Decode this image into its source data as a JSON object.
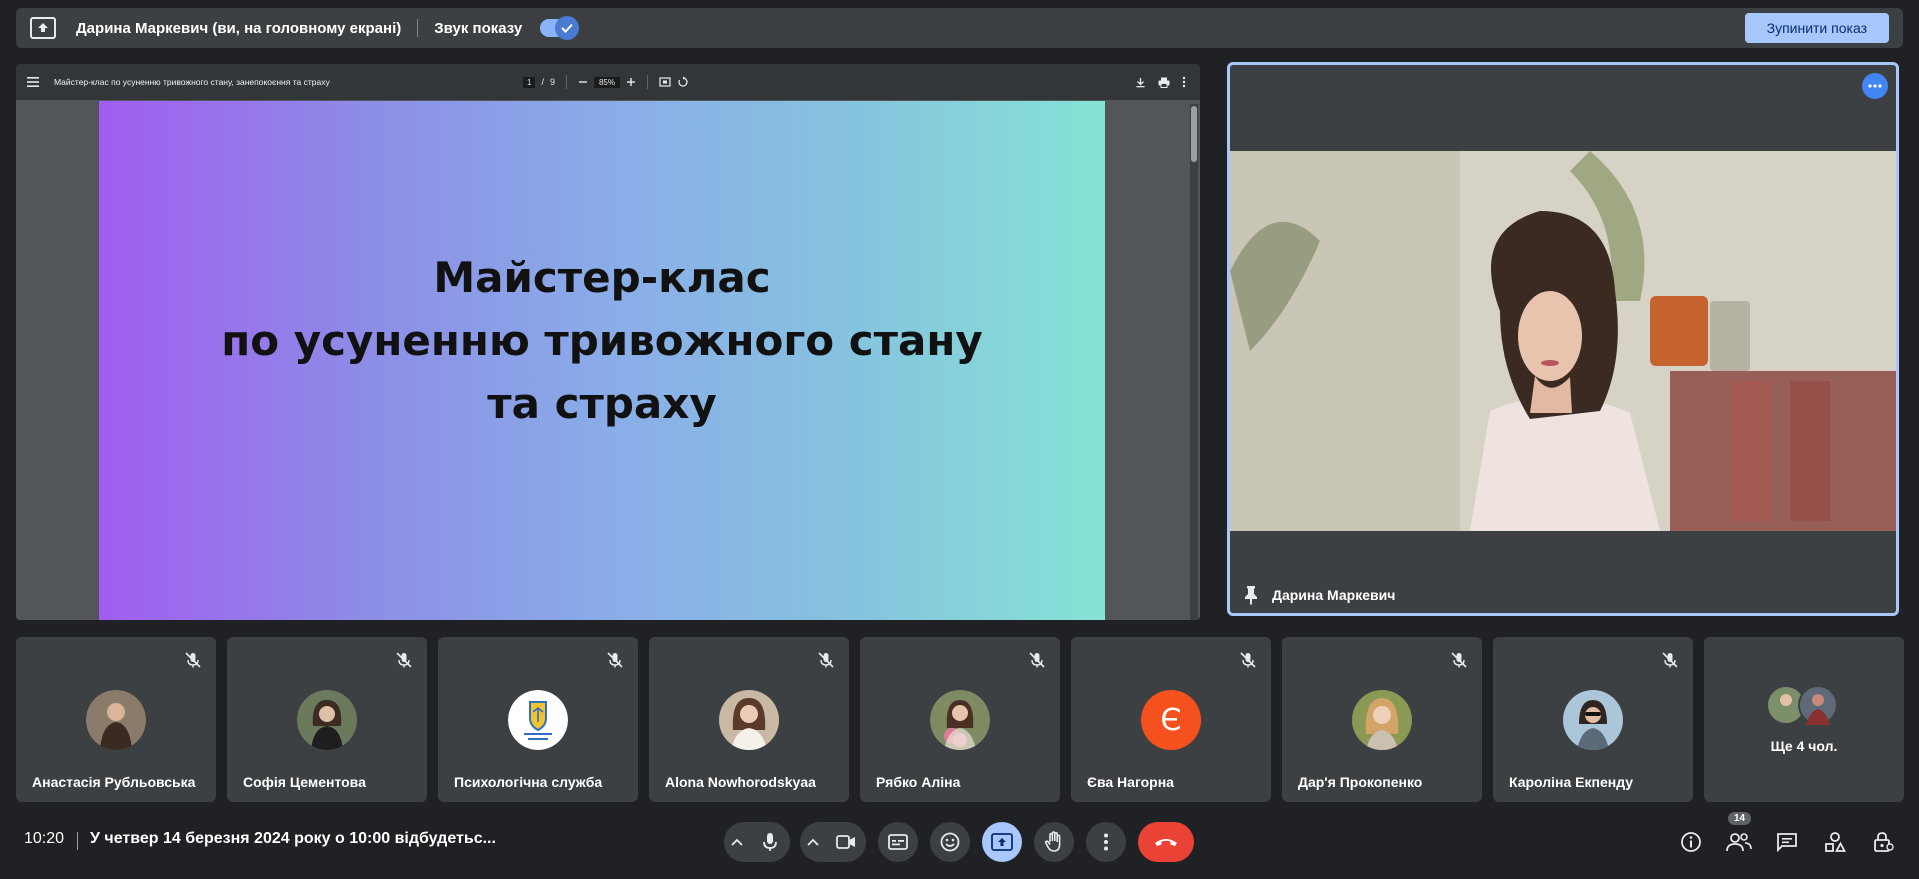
{
  "presenting_bar": {
    "presenter_label": "Дарина Маркевич (ви, на головному екрані)",
    "audio_label": "Звук показу",
    "audio_enabled": true,
    "stop_button": "Зупинити показ"
  },
  "pdf": {
    "doc_title": "Майстер-клас по усуненню тривожного стану, занепокоєння та страху",
    "page_current": "1",
    "page_separator": "/",
    "page_total": "9",
    "zoom": "85%",
    "slide_line1": "Майстер-клас",
    "slide_line2": "по усуненню тривожного стану",
    "slide_line3": "та страху"
  },
  "presenter_tile": {
    "name": "Дарина Маркевич"
  },
  "participants": [
    {
      "name": "Анастасія Рубльовська",
      "avatar_color": "#7a6a5a"
    },
    {
      "name": "Софія Цементова",
      "avatar_color": "#5d6b52"
    },
    {
      "name": "Психологічна служба",
      "avatar_color": "#ffffff"
    },
    {
      "name": "Alona Nowhorodskyaa",
      "avatar_color": "#a08a78"
    },
    {
      "name": "Рябко Аліна",
      "avatar_color": "#6b7d5a"
    },
    {
      "name": "Єва Нагорна",
      "avatar_letter": "Є",
      "avatar_color": "#f4511e"
    },
    {
      "name": "Дар'я Прокопенко",
      "avatar_color": "#8a9a5a"
    },
    {
      "name": "Кароліна Екпенду",
      "avatar_color": "#a9c4d8"
    }
  ],
  "more_people": {
    "label": "Ще 4 чол."
  },
  "bottom": {
    "time": "10:20",
    "meeting_title": "У четвер 14 березня 2024 року о 10:00 відбудетьс...",
    "people_count": "14"
  },
  "colors": {
    "accent": "#a8c7fa",
    "end_call": "#ea4335",
    "tile_bg": "#3c4043",
    "page_bg": "#202124"
  }
}
